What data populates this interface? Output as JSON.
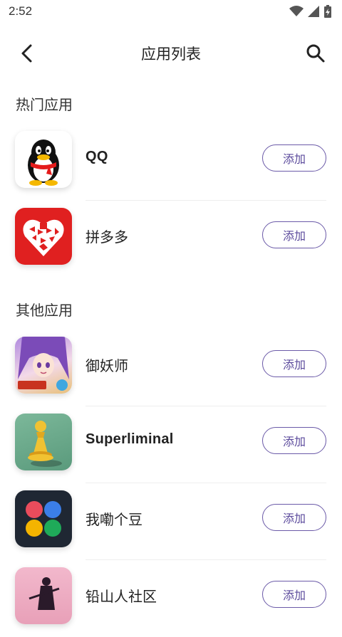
{
  "status": {
    "time": "2:52"
  },
  "header": {
    "title": "应用列表"
  },
  "sections": {
    "hot_title": "热门应用",
    "other_title": "其他应用"
  },
  "apps": [
    {
      "name": "QQ",
      "button": "添加",
      "icon": "qq-penguin-icon"
    },
    {
      "name": "拼多多",
      "button": "添加",
      "icon": "pinduoduo-heart-icon"
    },
    {
      "name": "御妖师",
      "button": "添加",
      "icon": "yuyaoshi-anime-girl-icon"
    },
    {
      "name": "Superliminal",
      "button": "添加",
      "icon": "chess-pawn-icon"
    },
    {
      "name": "我嘞个豆",
      "button": "添加",
      "icon": "four-dots-icon"
    },
    {
      "name": "铅山人社区",
      "button": "添加",
      "icon": "samurai-silhouette-icon"
    }
  ],
  "colors": {
    "accent": "#5b4a9c",
    "qq_bg": "#ffffff",
    "pdd_bg": "#e02020",
    "chess_bg": "#6ba887",
    "dots_bg": "#1f2733"
  }
}
